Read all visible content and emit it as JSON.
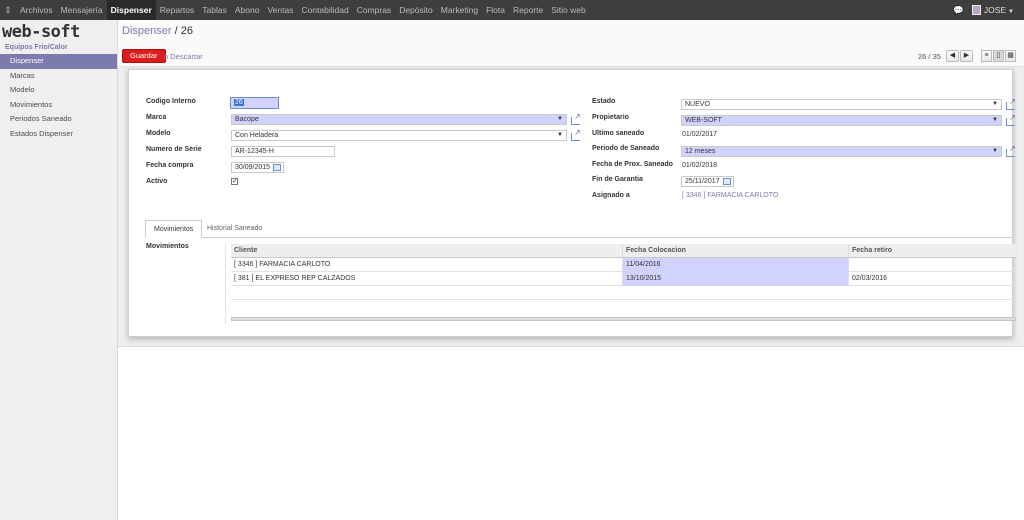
{
  "topbar": {
    "menu": [
      "Archivos",
      "Mensajería",
      "Dispenser",
      "Repartos",
      "Tablas",
      "Abono",
      "Ventas",
      "Contabilidad",
      "Compras",
      "Depósito",
      "Marketing",
      "Flota",
      "Reporte",
      "Sitio web"
    ],
    "active": "Dispenser",
    "user": "JOSE"
  },
  "sidebar": {
    "logo": "web-soft",
    "section": "Equipos Frio/Calor",
    "items": [
      "Dispenser",
      "Marcas",
      "Modelo",
      "Movimientos",
      "Periodos Saneado",
      "Estados Dispenser"
    ]
  },
  "header": {
    "breadcrumb_link": "Dispenser",
    "breadcrumb_sep": "/",
    "record": "26",
    "save_label": "Guardar",
    "or_label": "o",
    "discard_label": "Descartar",
    "pager": "26 / 35"
  },
  "form": {
    "left": {
      "codigo_interno": {
        "label": "Codigo Interno",
        "value": "26"
      },
      "marca": {
        "label": "Marca",
        "value": "Bacope"
      },
      "modelo": {
        "label": "Modelo",
        "value": "Con Heladera"
      },
      "numero_serie": {
        "label": "Numero de Serie",
        "value": "AR-12345-H"
      },
      "fecha_compra": {
        "label": "Fecha compra",
        "value": "30/09/2015"
      },
      "activo": {
        "label": "Activo",
        "checked": true
      }
    },
    "right": {
      "estado": {
        "label": "Estado",
        "value": "NUEVO"
      },
      "propietario": {
        "label": "Propietario",
        "value": "WEB-SOFT"
      },
      "ultimo_saneado": {
        "label": "Ultimo saneado",
        "value": "01/02/2017"
      },
      "periodo_saneado": {
        "label": "Periodo de Saneado",
        "value": "12 meses"
      },
      "fecha_prox_saneado": {
        "label": "Fecha de Prox. Saneado",
        "value": "01/02/2018"
      },
      "fin_garantia": {
        "label": "Fin de Garantia",
        "value": "25/11/2017"
      },
      "asignado_a": {
        "label": "Asignado a",
        "value": "[ 3346 ] FARMACIA CARLOTO"
      }
    }
  },
  "tabs": [
    "Movimientos",
    "Historial Saneado"
  ],
  "movimientos": {
    "label": "Movimientos",
    "columns": [
      "Cliente",
      "Fecha Colocacion",
      "Fecha retiro"
    ],
    "rows": [
      {
        "cliente": "[ 3346 ] FARMACIA CARLOTO",
        "fecha_colocacion": "11/04/2016",
        "fecha_retiro": ""
      },
      {
        "cliente": "[ 381 ] EL EXPRESO REP CALZADOS",
        "fecha_colocacion": "13/10/2015",
        "fecha_retiro": "02/03/2016"
      }
    ]
  },
  "colors": {
    "accent": "#7c7bad",
    "save": "#dc1d1d",
    "required": "#d2d2ff",
    "topbar": "#3e3e3e"
  }
}
